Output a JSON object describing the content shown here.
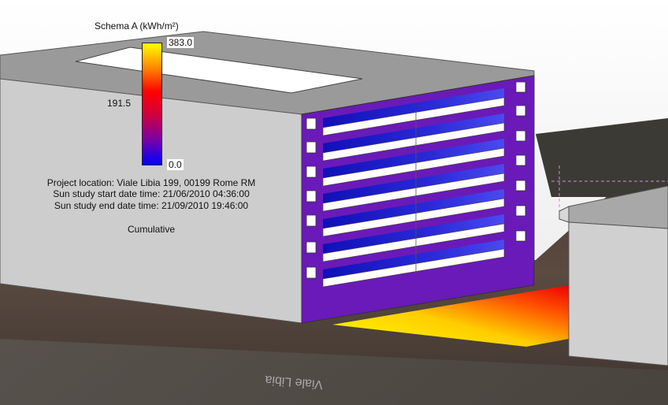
{
  "legend": {
    "title": "Schema A (kWh/m²)",
    "max_label": "383.0",
    "mid_label": "191.5",
    "min_label": "0.0",
    "colors": [
      "#ffff00",
      "#ff8800",
      "#ff0000",
      "#cc0044",
      "#7700aa",
      "#0000ff"
    ]
  },
  "info": {
    "project_location": "Project location: Viale Libia 199, 00199 Rome RM",
    "start": "Sun study start date time: 21/06/2010 04:36:00",
    "end": "Sun study end date time: 21/09/2010 19:46:00",
    "mode": "Cumulative"
  },
  "scene": {
    "building_color": "#c8c8c8",
    "roof_color": "#959595",
    "facade_color": "#6a1ab8",
    "window_band_color": "#1a1ac8",
    "ground_hot_color": "#ffee00",
    "road_label": "Viale Libia"
  }
}
